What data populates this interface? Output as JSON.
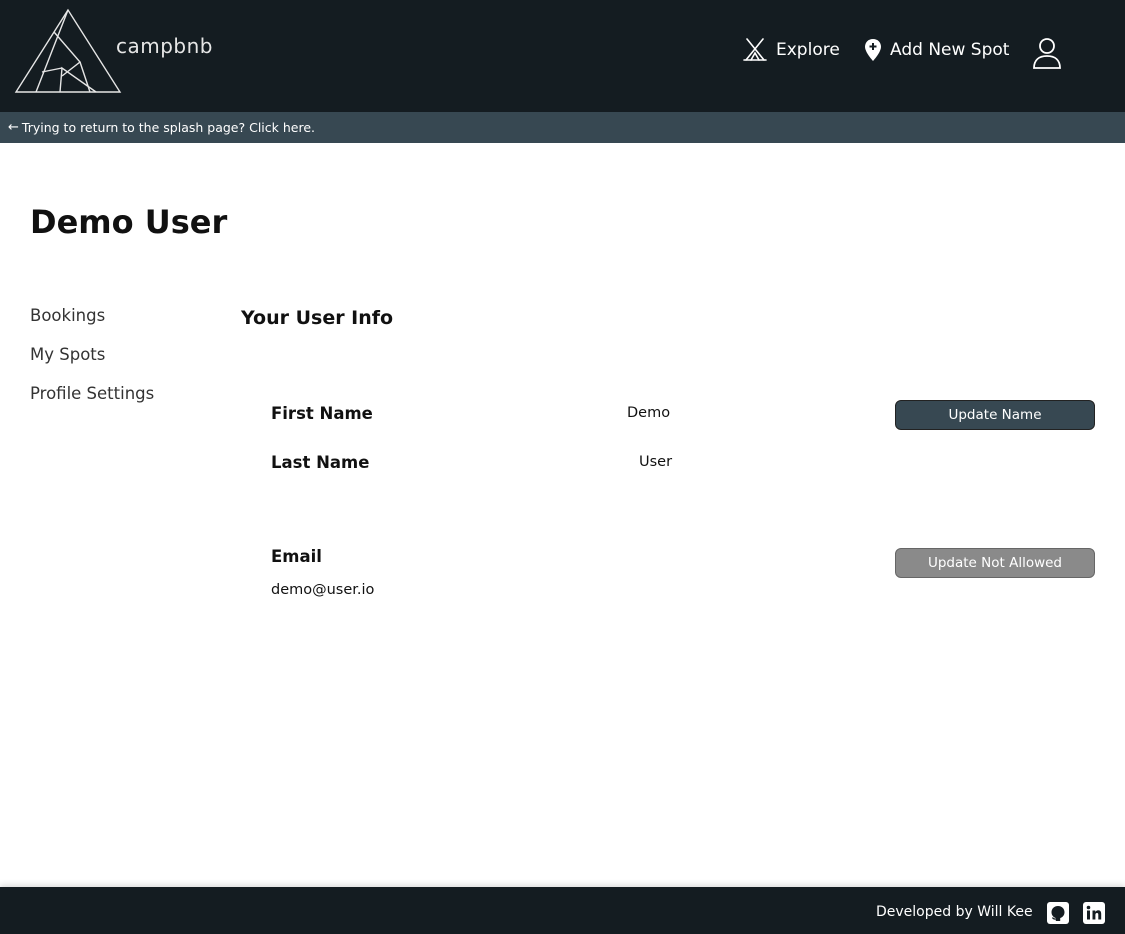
{
  "header": {
    "brand": "campbnb",
    "nav": {
      "explore_label": "Explore",
      "add_spot_label": "Add New Spot"
    },
    "icons": {
      "logo": "tent-triangle-logo",
      "explore": "tent-icon",
      "add_spot": "map-pin-plus-icon",
      "profile": "user-icon"
    }
  },
  "splash_bar": {
    "arrow": "←",
    "text": "Trying to return to the splash page? Click here."
  },
  "page": {
    "title": "Demo User"
  },
  "sidebar": {
    "items": [
      {
        "label": "Bookings"
      },
      {
        "label": "My Spots"
      },
      {
        "label": "Profile Settings"
      }
    ]
  },
  "user_info": {
    "section_title": "Your User Info",
    "first_name_label": "First Name",
    "first_name_value": "Demo",
    "last_name_label": "Last Name",
    "last_name_value": "User",
    "update_name_label": "Update Name",
    "email_label": "Email",
    "email_value": "demo@user.io",
    "update_email_label": "Update Not Allowed"
  },
  "footer": {
    "text": "Developed by Will Kee",
    "icons": [
      "github-icon",
      "linkedin-icon"
    ]
  },
  "colors": {
    "header_bg": "#141c21",
    "splash_bar_bg": "#374852",
    "primary_button": "#374852",
    "disabled_button": "#8a8a8a"
  }
}
